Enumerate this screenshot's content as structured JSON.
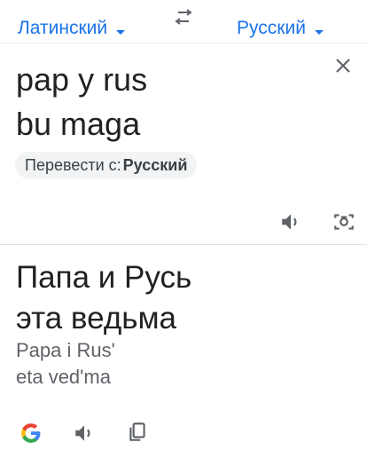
{
  "header": {
    "source_language": "Латинский",
    "target_language": "Русский"
  },
  "source": {
    "text": "pap y rus\nbu maga",
    "detect_prefix": "Перевести с:",
    "detect_language": "Русский"
  },
  "result": {
    "lines": [
      "Папа и Русь",
      "эта ведьма"
    ],
    "transliteration": [
      "Papa i Rus'",
      "eta ved'ma"
    ]
  },
  "colors": {
    "accent": "#1a73e8",
    "icon": "#5f6368"
  },
  "icons": [
    "swap-languages-icon",
    "chevron-down-icon",
    "close-icon",
    "speaker-icon",
    "camera-icon",
    "google-logo-icon",
    "copy-icon"
  ]
}
